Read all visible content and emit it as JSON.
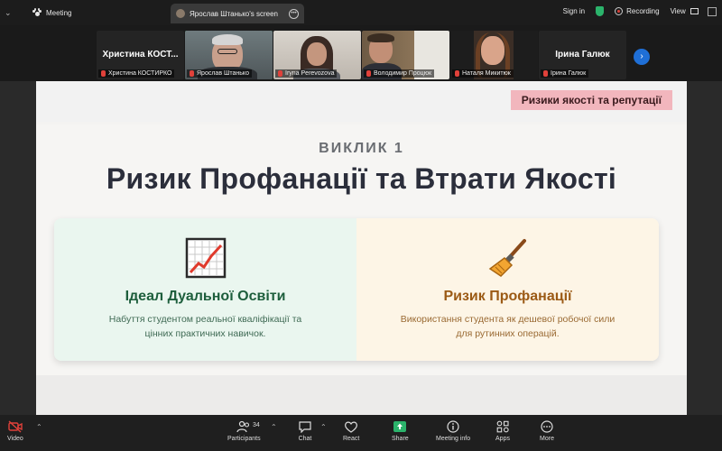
{
  "topbar": {
    "meeting_label": "Meeting",
    "tab_label": "Ярослав Штанько's screen",
    "sign_in": "Sign in",
    "recording": "Recording",
    "view": "View",
    "colors": {
      "shield": "#2bb36b",
      "record_dot": "#e0413a"
    }
  },
  "gallery": {
    "tiles": [
      {
        "display_name": "Христина  КОСТ...",
        "label": "Христина КОСТИРКО",
        "video": false
      },
      {
        "display_name": "",
        "label": "Ярослав Штанько",
        "video": true,
        "active": true
      },
      {
        "display_name": "",
        "label": "Iryna Perevozova",
        "video": true
      },
      {
        "display_name": "",
        "label": "Володимир Процюк",
        "video": true
      },
      {
        "display_name": "",
        "label": "Наталя Микитюк",
        "video": true
      },
      {
        "display_name": "Ірина Галюк",
        "label": "Ірина Галюк",
        "video": false
      }
    ],
    "next_icon": "chevron-right-icon"
  },
  "slide": {
    "tag": "Ризики якості та репутації",
    "kicker": "ВИКЛИК 1",
    "title": "Ризик Профанації та Втрати Якості",
    "left_card": {
      "icon": "chart-increasing-icon",
      "title": "Ідеал Дуальної Освіти",
      "desc_line1": "Набуття студентом реальної кваліфікації та",
      "desc_line2": "цінних практичних навичок."
    },
    "right_card": {
      "icon": "broom-icon",
      "title": "Ризик Профанації",
      "desc_line1": "Використання студента як дешевої робочої сили",
      "desc_line2": "для рутинних операцій."
    },
    "colors": {
      "tag_bg": "#f2b6bd",
      "left_bg": "#eaf6ef",
      "right_bg": "#fdf5e6",
      "left_title": "#1d5e3c",
      "right_title": "#9b5a15"
    }
  },
  "toolbar": {
    "video": "Video",
    "participants": "Participants",
    "participants_count": "34",
    "chat": "Chat",
    "react": "React",
    "share": "Share",
    "meeting_info": "Meeting info",
    "apps": "Apps",
    "more": "More",
    "colors": {
      "video_off": "#e0413a",
      "share": "#2bb36b"
    }
  }
}
